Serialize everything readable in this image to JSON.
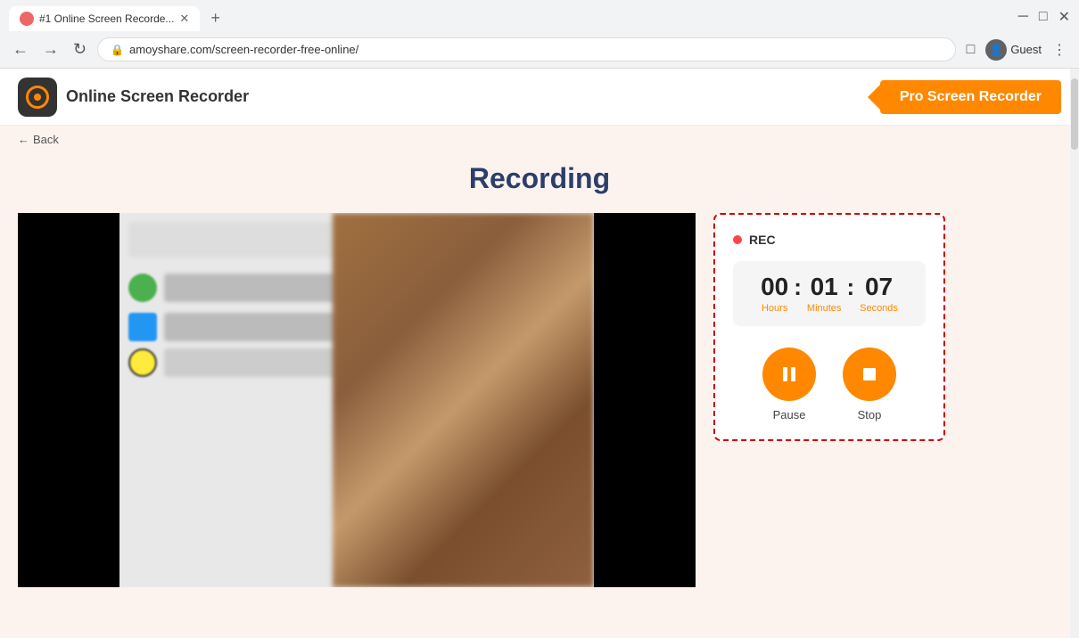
{
  "browser": {
    "tab_title": "#1 Online Screen Recorde...",
    "tab_favicon_color": "#cc3333",
    "url": "amoyshare.com/screen-recorder-free-online/",
    "profile_label": "Guest",
    "new_tab_label": "+",
    "nav": {
      "back": "←",
      "forward": "→",
      "refresh": "↻"
    }
  },
  "header": {
    "logo_alt": "Online Screen Recorder logo",
    "site_title": "Online Screen Recorder",
    "pro_btn_label": "Pro Screen Recorder"
  },
  "back_link": {
    "arrow": "←",
    "label": "Back"
  },
  "main": {
    "page_title": "Recording",
    "recording_panel": {
      "rec_label": "REC",
      "timer": {
        "hours": "00",
        "minutes": "01",
        "seconds": "07",
        "hours_label": "Hours",
        "minutes_label": "Minutes",
        "seconds_label": "Seconds"
      },
      "pause_label": "Pause",
      "stop_label": "Stop"
    }
  }
}
